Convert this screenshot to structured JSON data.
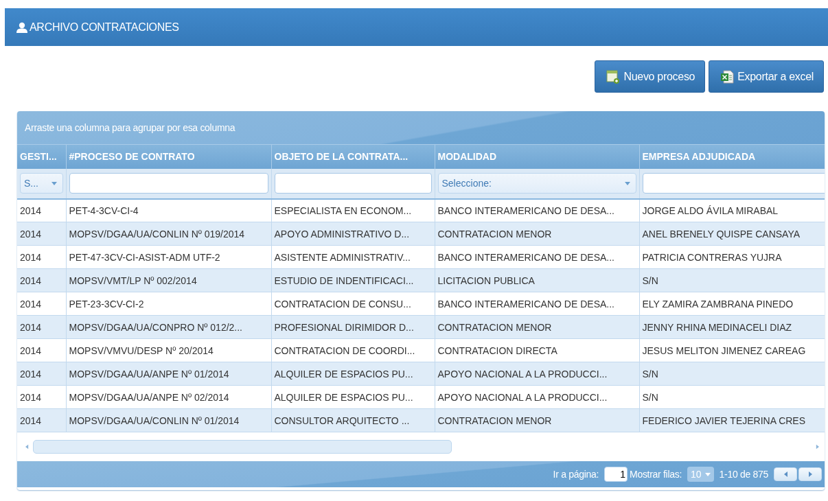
{
  "header": {
    "title": "ARCHIVO CONTRATACIONES"
  },
  "actions": [
    {
      "label": "Nuevo proceso",
      "kind": "new"
    },
    {
      "label": "Exportar a excel",
      "kind": "excel"
    }
  ],
  "grid": {
    "group_hint": "Arraste una columna para agrupar por esa columna",
    "columns": [
      {
        "label": "GESTI...",
        "filter": {
          "kind": "select",
          "value": "S..."
        }
      },
      {
        "label": "#PROCESO DE CONTRATO",
        "filter": {
          "kind": "text"
        }
      },
      {
        "label": "OBJETO DE LA CONTRATA...",
        "filter": {
          "kind": "text"
        }
      },
      {
        "label": "MODALIDAD",
        "filter": {
          "kind": "select",
          "value": "Seleccione:"
        }
      },
      {
        "label": "EMPRESA ADJUDICADA",
        "filter": {
          "kind": "text"
        }
      }
    ],
    "rows": [
      [
        "2014",
        "PET-4-3CV-CI-4",
        "ESPECIALISTA EN ECONOM...",
        "BANCO INTERAMERICANO DE DESA...",
        "JORGE ALDO ÁVILA MIRABAL"
      ],
      [
        "2014",
        "MOPSV/DGAA/UA/CONLIN Nº 019/2014",
        "APOYO ADMINISTRATIVO D...",
        "CONTRATACION MENOR",
        "ANEL BRENELY QUISPE CANSAYA"
      ],
      [
        "2014",
        "PET-47-3CV-CI-ASIST-ADM UTF-2",
        "ASISTENTE ADMINISTRATIV...",
        "BANCO INTERAMERICANO DE DESA...",
        "PATRICIA CONTRERAS YUJRA"
      ],
      [
        "2014",
        "MOPSV/VMT/LP Nº 002/2014",
        "ESTUDIO DE INDENTIFICACI...",
        "LICITACION PUBLICA",
        "S/N"
      ],
      [
        "2014",
        "PET-23-3CV-CI-2",
        "CONTRATACION DE CONSU...",
        "BANCO INTERAMERICANO DE DESA...",
        "ELY ZAMIRA ZAMBRANA PINEDO"
      ],
      [
        "2014",
        "MOPSV/DGAA/UA/CONPRO Nº 012/2...",
        "PROFESIONAL DIRIMIDOR D...",
        "CONTRATACION MENOR",
        "JENNY RHINA MEDINACELI DIAZ"
      ],
      [
        "2014",
        "MOPSV/VMVU/DESP Nº 20/2014",
        "CONTRATACION DE COORDI...",
        "CONTRATACION DIRECTA",
        "JESUS MELITON JIMENEZ CAREAG"
      ],
      [
        "2014",
        "MOPSV/DGAA/UA/ANPE Nº 01/2014",
        "ALQUILER DE ESPACIOS PU...",
        "APOYO NACIONAL A LA PRODUCCI...",
        "S/N"
      ],
      [
        "2014",
        "MOPSV/DGAA/UA/ANPE Nº 02/2014",
        "ALQUILER DE ESPACIOS PU...",
        "APOYO NACIONAL A LA PRODUCCI...",
        "S/N"
      ],
      [
        "2014",
        "MOPSV/DGAA/UA/CONLIN Nº 01/2014",
        "CONSULTOR ARQUITECTO ...",
        "CONTRATACION MENOR",
        "FEDERICO JAVIER TEJERINA CRES"
      ]
    ],
    "pager": {
      "goto_label": "Ir a página:",
      "page": "1",
      "rows_label": "Mostrar filas:",
      "rows_per_page": "10",
      "range": "1-10 de 875"
    }
  }
}
